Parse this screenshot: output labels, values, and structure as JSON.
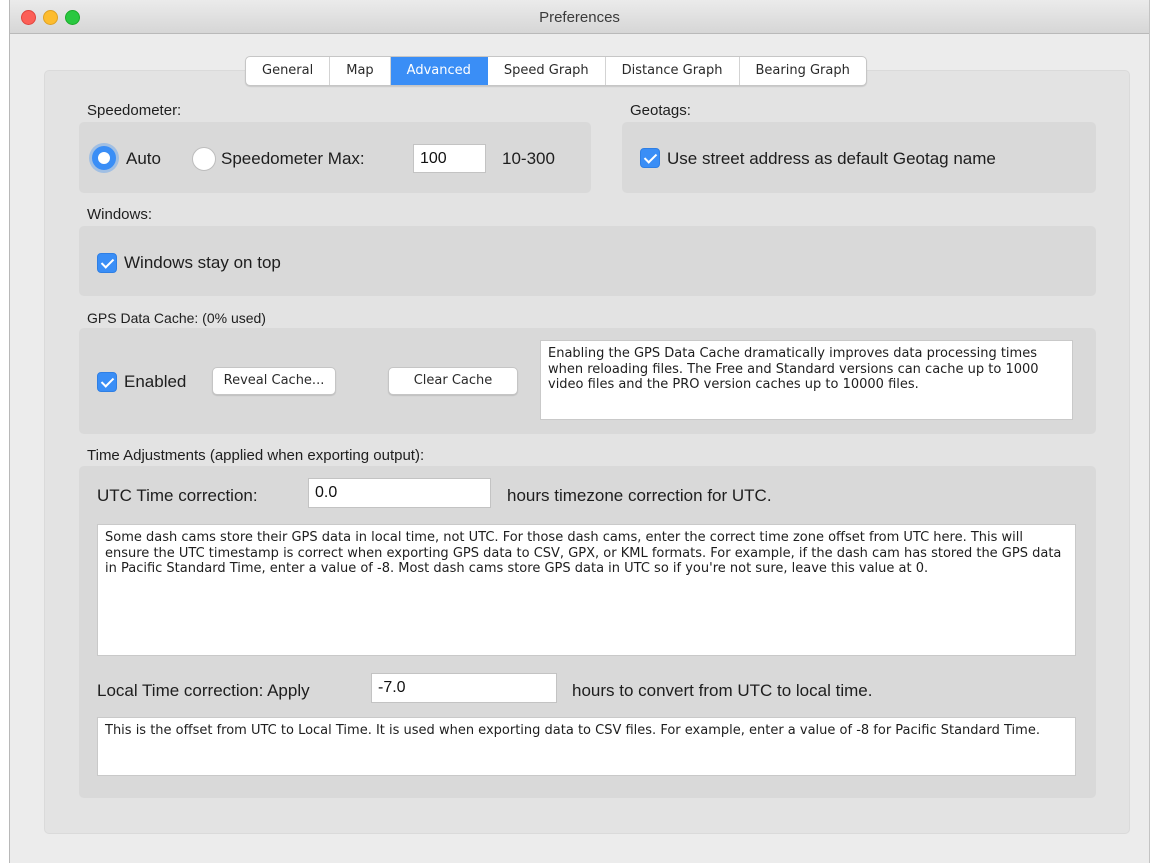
{
  "window": {
    "title": "Preferences"
  },
  "tabs": [
    {
      "label": "General",
      "active": false
    },
    {
      "label": "Map",
      "active": false
    },
    {
      "label": "Advanced",
      "active": true
    },
    {
      "label": "Speed Graph",
      "active": false
    },
    {
      "label": "Distance Graph",
      "active": false
    },
    {
      "label": "Bearing Graph",
      "active": false
    }
  ],
  "speedometer": {
    "heading": "Speedometer:",
    "auto_label": "Auto",
    "auto_selected": true,
    "max_label": "Speedometer Max:",
    "max_value": "100",
    "range_label": "10-300"
  },
  "geotags": {
    "heading": "Geotags:",
    "street_address_label": "Use street address as default Geotag name",
    "street_address_checked": true
  },
  "windows": {
    "heading": "Windows:",
    "stay_on_top_label": "Windows stay on top",
    "stay_on_top_checked": true
  },
  "cache": {
    "heading": "GPS Data Cache: (0% used)",
    "enabled_label": "Enabled",
    "enabled_checked": true,
    "reveal_button": "Reveal Cache...",
    "clear_button": "Clear Cache",
    "description": "Enabling the GPS Data Cache dramatically improves data processing times when reloading files. The Free and Standard versions can cache up to 1000 video files and the PRO version caches up to 10000 files."
  },
  "time": {
    "heading": "Time Adjustments (applied when exporting output):",
    "utc_label": "UTC Time correction:",
    "utc_value": "0.0",
    "utc_suffix": "hours timezone correction for UTC.",
    "utc_description": "Some dash cams store their GPS data in local time, not UTC. For those dash cams, enter the correct time zone offset from UTC here. This will ensure the UTC timestamp is correct when exporting GPS data to CSV, GPX, or KML formats. For example, if the dash cam has stored the GPS data in Pacific Standard Time, enter a value of -8. Most dash cams store GPS data in UTC so if you're not sure, leave this value at 0.",
    "local_label": "Local Time correction: Apply",
    "local_value": "-7.0",
    "local_suffix": "hours to convert from UTC to local time.",
    "local_description": "This is the offset from UTC to Local Time. It is used when exporting data to CSV files. For example, enter a value of -8 for Pacific Standard Time."
  }
}
